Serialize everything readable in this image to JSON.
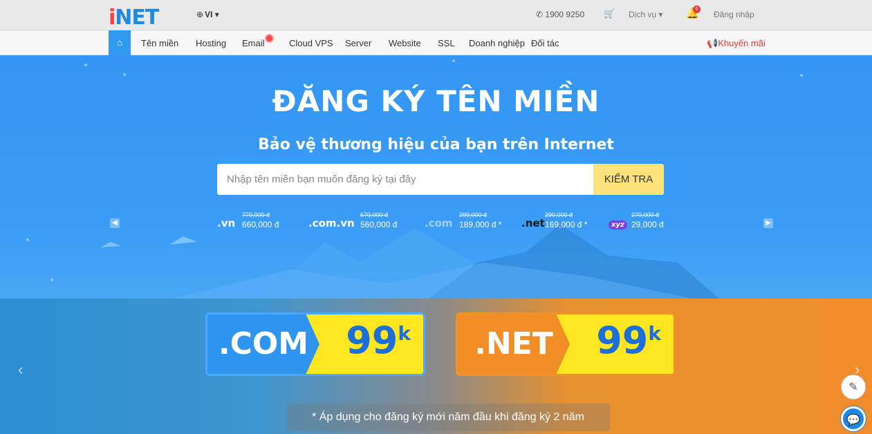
{
  "topbar": {
    "logo": "iNET",
    "lang": "VI",
    "phone": "1900 9250",
    "services": "Dịch vụ",
    "notifications": "6",
    "login": "Đăng nhập"
  },
  "nav": {
    "items": [
      "Tên miền",
      "Hosting",
      "Email",
      "Cloud VPS",
      "Server",
      "Website",
      "SSL",
      "Doanh nghiệp",
      "Đối tác"
    ],
    "promo": "Khuyến mãi"
  },
  "hero": {
    "title": "ĐĂNG KÝ TÊN MIỀN",
    "subtitle": "Bảo vệ thương hiệu của bạn trên Internet",
    "search_placeholder": "Nhập tên miền bạn muốn đăng ký tại đây",
    "check_button": "KIỂM TRA",
    "prices": [
      {
        "ext": ".vn",
        "old": "770,000 đ",
        "new": "660,000 đ"
      },
      {
        "ext": ".com.vn",
        "old": "670,000 đ",
        "new": "560,000 đ"
      },
      {
        "ext": ".com",
        "old": "299,000 đ",
        "new": "189,000 đ *"
      },
      {
        "ext": ".net",
        "old": "290,000 đ",
        "new": "169,000 đ *"
      },
      {
        "ext": "xyz",
        "old": "270,000 đ",
        "new": "29,000 đ"
      }
    ]
  },
  "banner": {
    "com_label": ".COM",
    "com_value": "99",
    "net_label": ".NET",
    "net_value": "99",
    "unit": "k",
    "note": "* Áp dụng cho đăng ký mới năm đầu khi đăng ký 2 năm"
  }
}
